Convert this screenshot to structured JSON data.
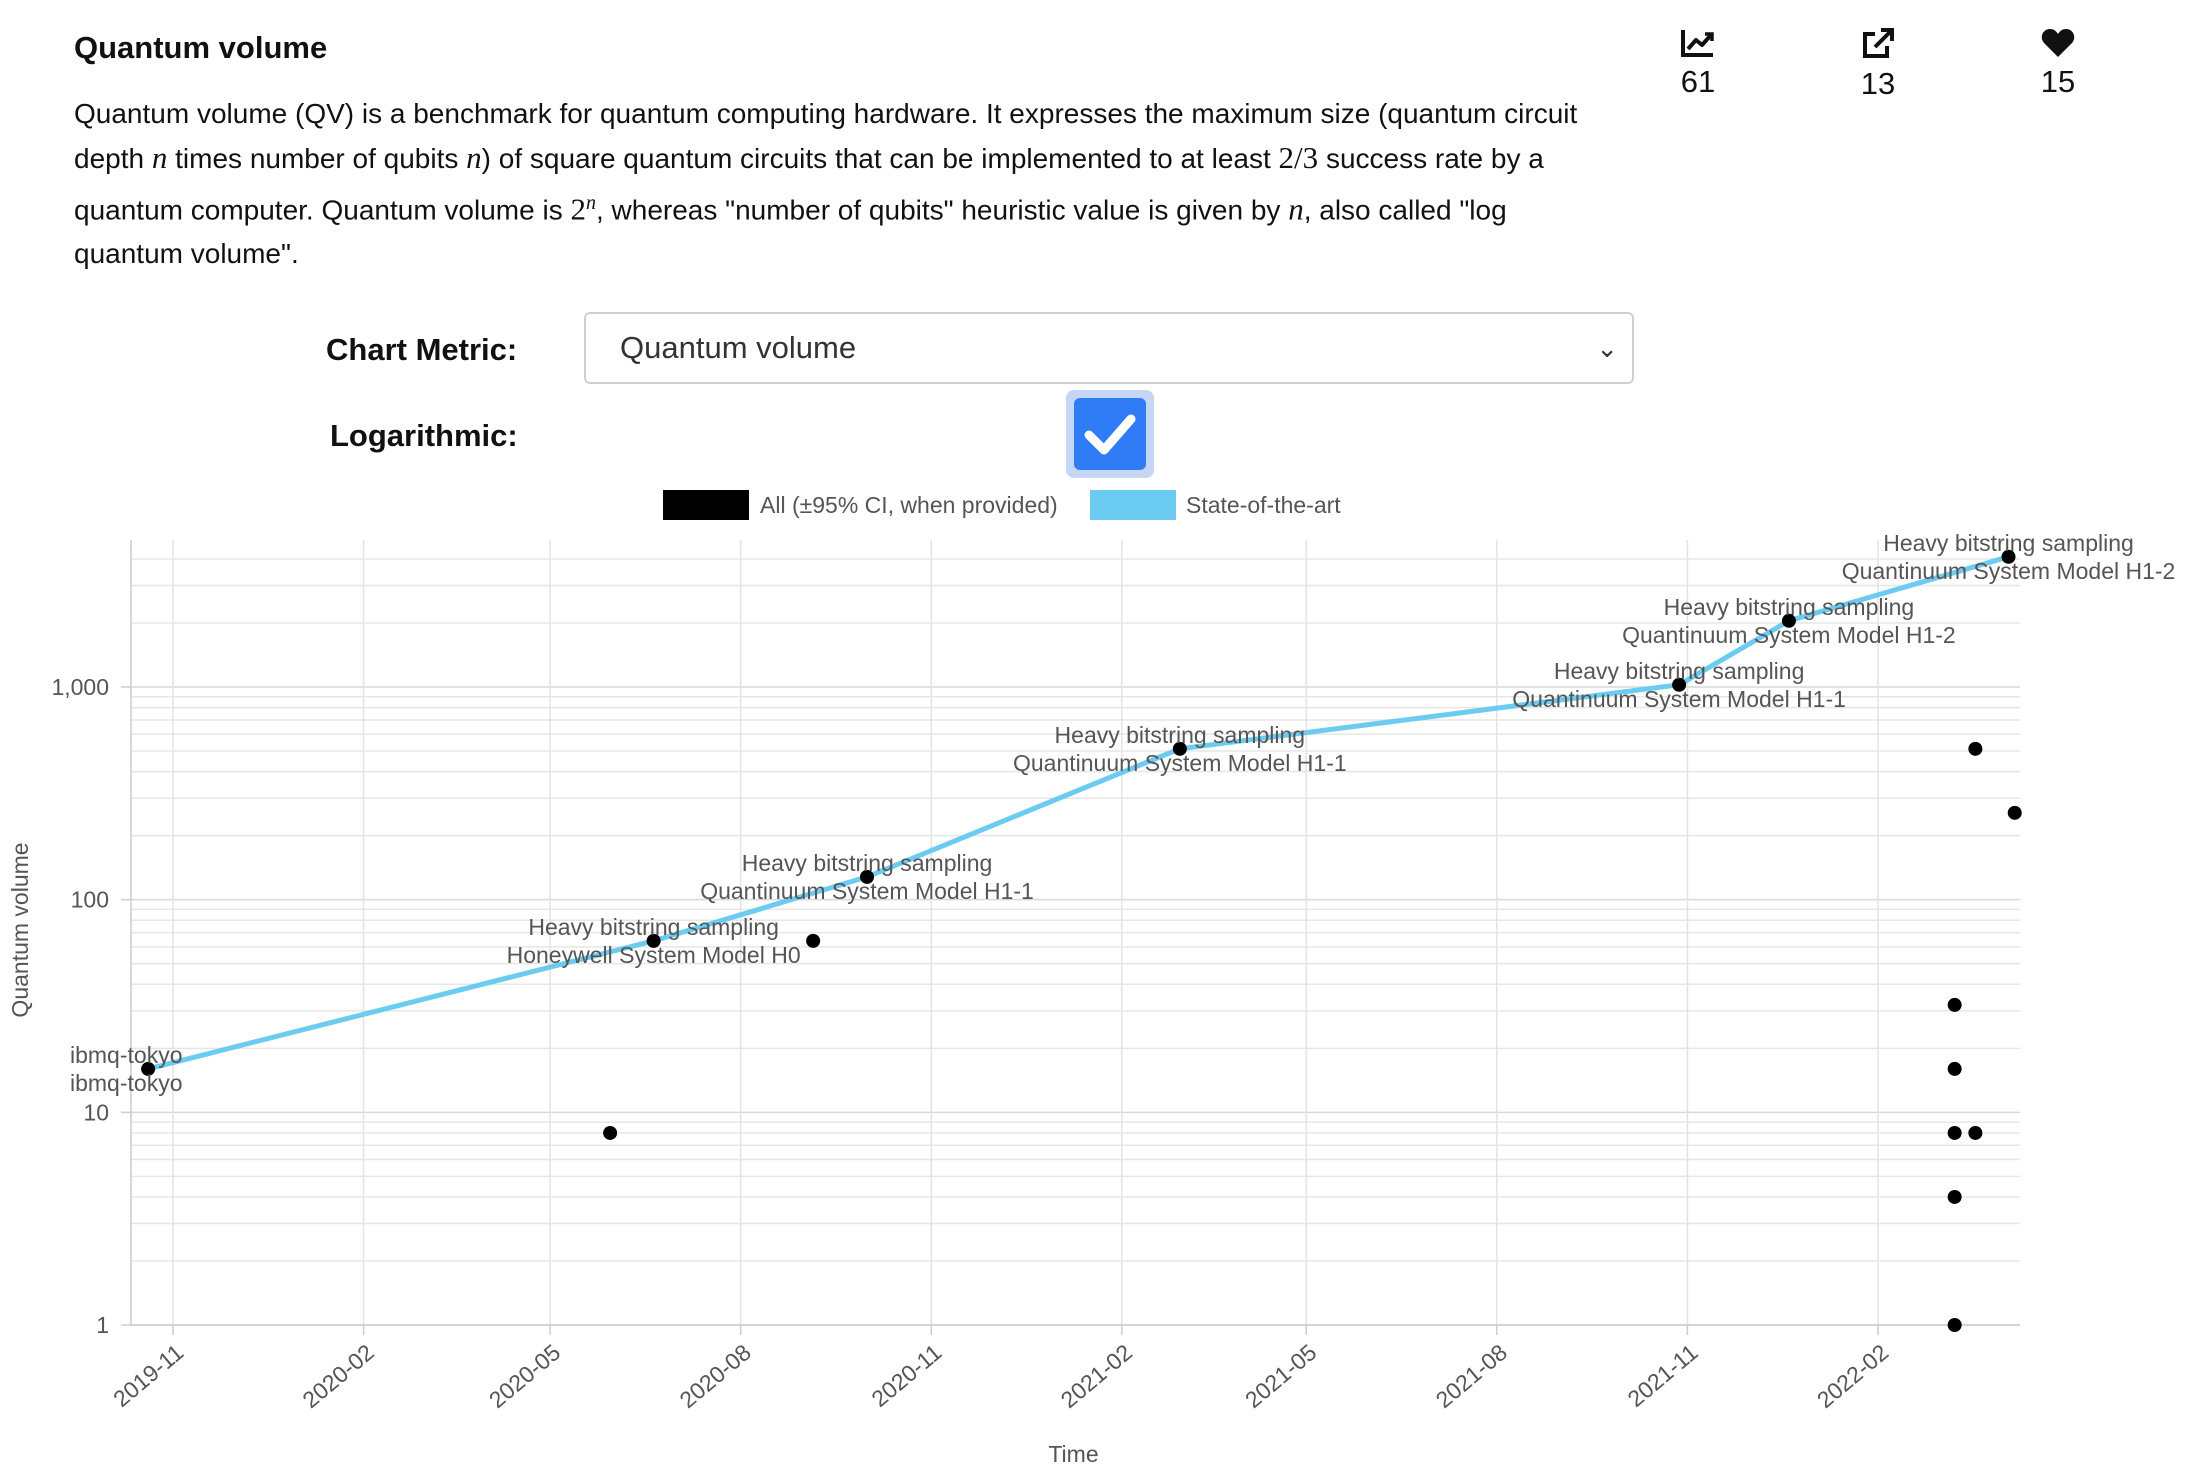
{
  "header": {
    "title": "Quantum volume",
    "description_parts": {
      "p1": "Quantum volume (QV) is a benchmark for quantum computing hardware. It expresses the maximum size (quantum circuit depth ",
      "m1": "n",
      "p2": " times number of qubits ",
      "m2": "n",
      "p3": ") of square quantum circuits that can be implemented to at least ",
      "m3": "2/3",
      "p4": " success rate by a quantum computer. Quantum volume is ",
      "m4": "2",
      "m4sup": "n",
      "p5": ", whereas \"number of qubits\" heuristic value is given by ",
      "m5": "n",
      "p6": ", also called \"log quantum volume\"."
    }
  },
  "stats": [
    {
      "icon": "chart-line-icon",
      "value": "61"
    },
    {
      "icon": "external-link-icon",
      "value": "13"
    },
    {
      "icon": "heart-icon",
      "value": "15"
    }
  ],
  "controls": {
    "metric_label": "Chart Metric:",
    "metric_value": "Quantum volume",
    "log_label": "Logarithmic:",
    "log_checked": true
  },
  "colors": {
    "sota": "#6ccbf1",
    "points": "#000000",
    "checkbox": "#2f7cf6"
  },
  "chart_data": {
    "type": "line",
    "xlabel": "Time",
    "ylabel": "Quantum volume",
    "yscale": "log",
    "ylim": [
      1,
      4096
    ],
    "y_ticks": [
      {
        "value": 1,
        "label": "1"
      },
      {
        "value": 10,
        "label": "10"
      },
      {
        "value": 100,
        "label": "100"
      },
      {
        "value": 1000,
        "label": "1,000"
      }
    ],
    "x_ticks": [
      "2019-11",
      "2020-02",
      "2020-05",
      "2020-08",
      "2020-11",
      "2021-02",
      "2021-05",
      "2021-08",
      "2021-11",
      "2022-02"
    ],
    "legend": [
      {
        "name": "All (±95% CI, when provided)",
        "color": "#000000"
      },
      {
        "name": "State-of-the-art",
        "color": "#6ccbf1"
      }
    ],
    "legend_position": "top",
    "grid": true,
    "series": [
      {
        "name": "State-of-the-art",
        "points": [
          {
            "x": "2019-10-20",
            "y": 16
          },
          {
            "x": "2020-06-20",
            "y": 64
          },
          {
            "x": "2020-10-01",
            "y": 128
          },
          {
            "x": "2021-03-01",
            "y": 512
          },
          {
            "x": "2021-10-28",
            "y": 1024
          },
          {
            "x": "2021-12-20",
            "y": 2048
          },
          {
            "x": "2022-04-05",
            "y": 4096
          }
        ]
      },
      {
        "name": "All (±95% CI, when provided)",
        "points": [
          {
            "x": "2019-10-20",
            "y": 16
          },
          {
            "x": "2020-05-30",
            "y": 8
          },
          {
            "x": "2020-06-20",
            "y": 64
          },
          {
            "x": "2020-09-05",
            "y": 64
          },
          {
            "x": "2020-10-01",
            "y": 128
          },
          {
            "x": "2021-03-01",
            "y": 512
          },
          {
            "x": "2021-10-28",
            "y": 1024
          },
          {
            "x": "2021-12-20",
            "y": 2048
          },
          {
            "x": "2022-03-10",
            "y": 32
          },
          {
            "x": "2022-03-10",
            "y": 16
          },
          {
            "x": "2022-03-10",
            "y": 8
          },
          {
            "x": "2022-03-10",
            "y": 4
          },
          {
            "x": "2022-03-10",
            "y": 1
          },
          {
            "x": "2022-03-20",
            "y": 8
          },
          {
            "x": "2022-03-20",
            "y": 512
          },
          {
            "x": "2022-04-08",
            "y": 256
          },
          {
            "x": "2022-04-05",
            "y": 4096
          }
        ]
      }
    ],
    "annotations": [
      {
        "x": "2019-10-20",
        "y": 16,
        "line1": "ibmq-tokyo",
        "line2": "ibmq-tokyo"
      },
      {
        "x": "2020-06-20",
        "y": 64,
        "line1": "Heavy bitstring sampling",
        "line2": "Honeywell System Model H0"
      },
      {
        "x": "2020-10-01",
        "y": 128,
        "line1": "Heavy bitstring sampling",
        "line2": "Quantinuum System Model H1-1"
      },
      {
        "x": "2021-03-01",
        "y": 512,
        "line1": "Heavy bitstring sampling",
        "line2": "Quantinuum System Model H1-1"
      },
      {
        "x": "2021-10-28",
        "y": 1024,
        "line1": "Heavy bitstring sampling",
        "line2": "Quantinuum System Model H1-1"
      },
      {
        "x": "2021-12-20",
        "y": 2048,
        "line1": "Heavy bitstring sampling",
        "line2": "Quantinuum System Model H1-2"
      },
      {
        "x": "2022-04-05",
        "y": 4096,
        "line1": "Heavy bitstring sampling",
        "line2": "Quantinuum System Model H1-2"
      }
    ]
  }
}
